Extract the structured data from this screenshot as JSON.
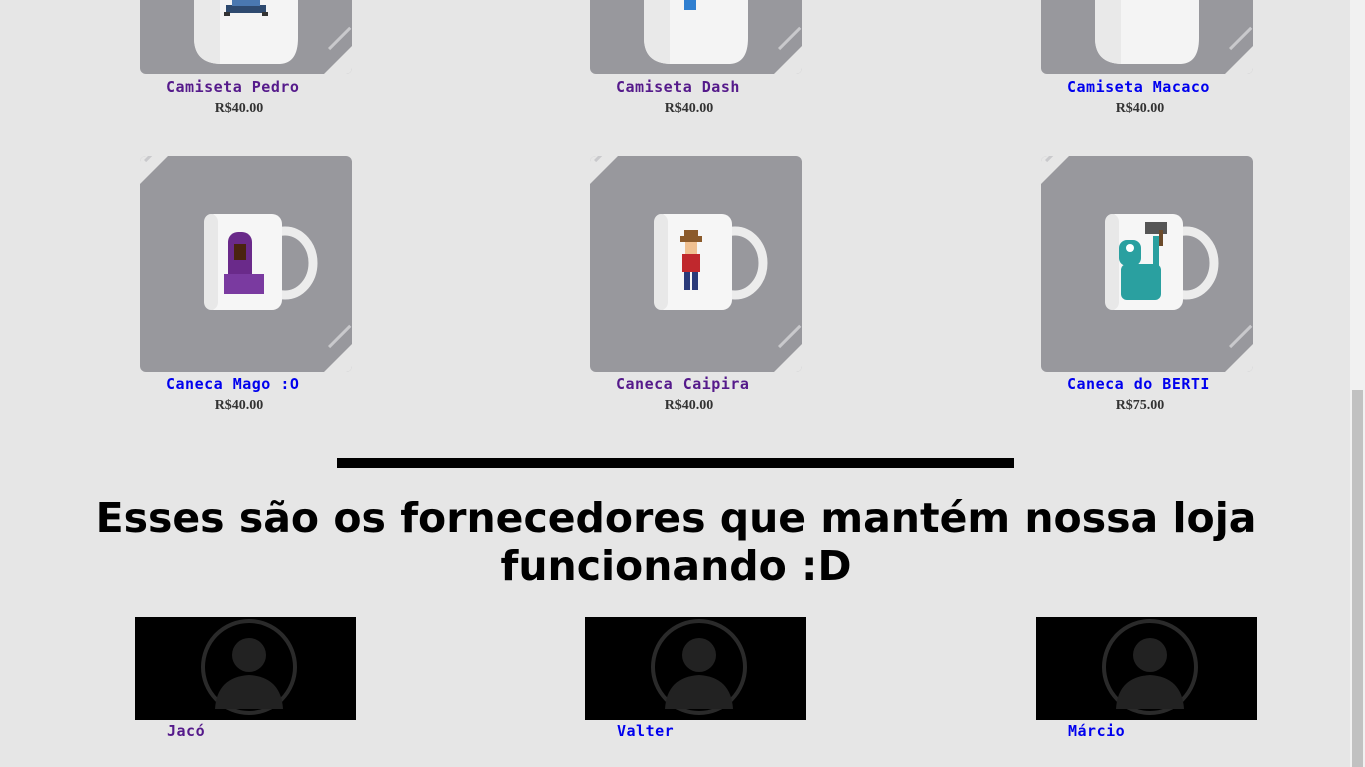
{
  "products": [
    {
      "name": "Camiseta Pedro",
      "price": "R$40.00",
      "item": "tshirt",
      "visited": true
    },
    {
      "name": "Camiseta Dash",
      "price": "R$40.00",
      "item": "tshirt",
      "visited": true
    },
    {
      "name": "Camiseta Macaco",
      "price": "R$40.00",
      "item": "tshirt",
      "visited": false
    },
    {
      "name": "Caneca Mago :O",
      "price": "R$40.00",
      "item": "mug-wizard",
      "visited": false
    },
    {
      "name": "Caneca Caipira",
      "price": "R$40.00",
      "item": "mug-farmer",
      "visited": true
    },
    {
      "name": "Caneca do BERTI",
      "price": "R$75.00",
      "item": "mug-monster",
      "visited": false
    }
  ],
  "suppliers_title": "Esses são os fornecedores que mantém nossa loja funcionando :D",
  "suppliers": [
    {
      "name": "Jacó",
      "visited": true
    },
    {
      "name": "Valter",
      "visited": false
    },
    {
      "name": "Márcio",
      "visited": false
    }
  ],
  "colors": {
    "background": "#e6e6e6",
    "card": "#98989d",
    "visited_link": "#551a8b",
    "link": "#0000ee"
  }
}
